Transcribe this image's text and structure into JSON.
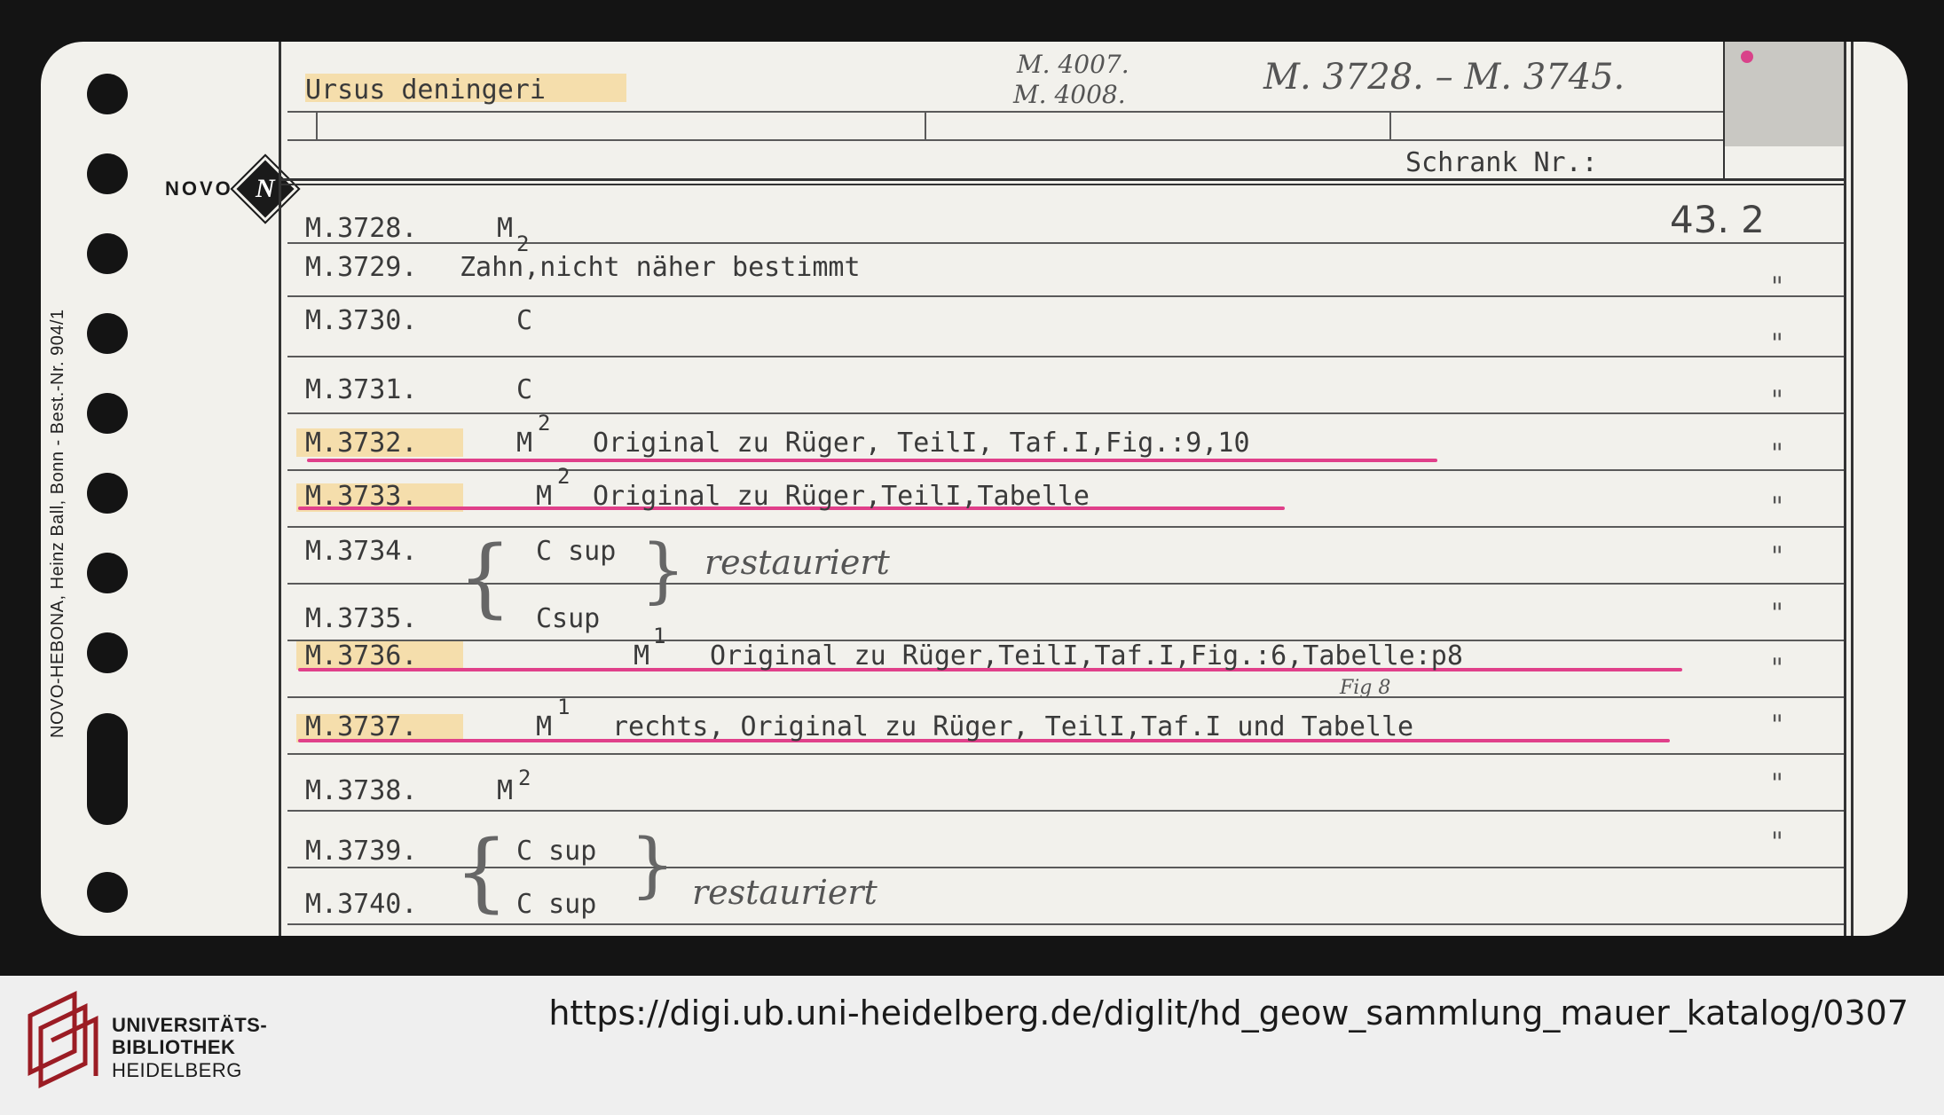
{
  "card": {
    "species": "Ursus deningeri",
    "header_hand_1": "M. 4007.",
    "header_hand_2": "M. 4008.",
    "header_range": "M. 3728. – M. 3745.",
    "schrank_label": "Schrank Nr.:",
    "schrank_value": "43. 2",
    "brand": "NOVO",
    "brand_mark": "N",
    "side_print": "NOVO-HEBONA, Heinz Ball, Bonn - Best.-Nr. 904/1"
  },
  "rows": [
    {
      "id": "M.3728.",
      "tooth": "M",
      "sub": "2",
      "desc": ""
    },
    {
      "id": "M.3729.",
      "tooth": "",
      "desc": "Zahn,nicht näher bestimmt"
    },
    {
      "id": "M.3730.",
      "tooth": "C",
      "desc": ""
    },
    {
      "id": "M.3731.",
      "tooth": "C",
      "desc": ""
    },
    {
      "id": "M.3732.",
      "tooth": "M",
      "sup": "2",
      "desc": "Original zu Rüger, TeilI, Taf.I,Fig.:9,10"
    },
    {
      "id": "M.3733.",
      "tooth": "M",
      "sup": "2",
      "desc": "Original zu Rüger,TeilI,Tabelle"
    },
    {
      "id": "M.3734.",
      "tooth": "C sup",
      "desc": ""
    },
    {
      "id": "M.3735.",
      "tooth": "Csup",
      "desc": ""
    },
    {
      "id": "M.3736.",
      "tooth": "M",
      "sup": "1",
      "desc": "Original zu Rüger,TeilI,Taf.I,Fig.:6,Tabelle:p8"
    },
    {
      "id": "M.3737.",
      "tooth": "M",
      "sup": "1",
      "desc": "rechts, Original zu Rüger, TeilI,Taf.I und Tabelle",
      "insert": "Fig 8"
    },
    {
      "id": "M.3738.",
      "tooth": "M",
      "sup": "2",
      "desc": ""
    },
    {
      "id": "M.3739.",
      "tooth": "C sup",
      "desc": ""
    },
    {
      "id": "M.3740.",
      "tooth": "C sup",
      "desc": ""
    }
  ],
  "notes": {
    "restauriert_1": "restauriert",
    "restauriert_2": "restauriert"
  },
  "ditto": [
    "\"",
    "\"",
    "\"",
    "\"",
    "\"",
    "\"",
    "\"",
    "\"",
    "\"",
    "\"",
    "\""
  ],
  "footer": {
    "line1": "UNIVERSITÄTS-",
    "line2": "BIBLIOTHEK",
    "line3": "HEIDELBERG",
    "url": "https://digi.ub.uni-heidelberg.de/diglit/hd_geow_sammlung_mauer_katalog/0307"
  },
  "colors": {
    "highlighter": "#f7cd78",
    "underline": "#e0408a",
    "card": "#f2f1ec"
  }
}
